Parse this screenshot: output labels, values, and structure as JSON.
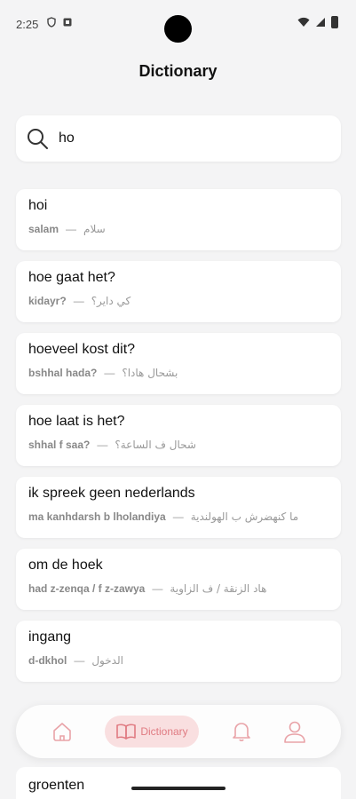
{
  "status": {
    "time": "2:25"
  },
  "header": {
    "title": "Dictionary"
  },
  "search": {
    "value": "ho",
    "placeholder": ""
  },
  "results": [
    {
      "term": "hoi",
      "translit": "salam",
      "arabic": "سلام"
    },
    {
      "term": "hoe gaat het?",
      "translit": "kidayr?",
      "arabic": "كي داير؟"
    },
    {
      "term": "hoeveel kost dit?",
      "translit": "bshhal hada?",
      "arabic": "بشحال هادا؟"
    },
    {
      "term": "hoe laat is het?",
      "translit": "shhal f saa?",
      "arabic": "شحال ف الساعة؟"
    },
    {
      "term": "ik spreek geen nederlands",
      "translit": "ma kanhdarsh b lholandiya",
      "arabic": "ما كنهضرش ب الهولندية"
    },
    {
      "term": "om de hoek",
      "translit": "had z-zenqa / f z-zawya",
      "arabic": "هاد الزنقة / ف الزاوية"
    },
    {
      "term": "ingang",
      "translit": "d-dkhol",
      "arabic": "الدخول"
    }
  ],
  "partial_result": {
    "term": "groenten"
  },
  "nav": {
    "items": [
      {
        "id": "home",
        "icon": "home-icon"
      },
      {
        "id": "dictionary",
        "icon": "book-icon",
        "label": "Dictionary"
      },
      {
        "id": "notifications",
        "icon": "bell-icon"
      },
      {
        "id": "profile",
        "icon": "user-icon"
      }
    ],
    "accent": "#e07b82",
    "active_bg": "#f9dfe0"
  }
}
